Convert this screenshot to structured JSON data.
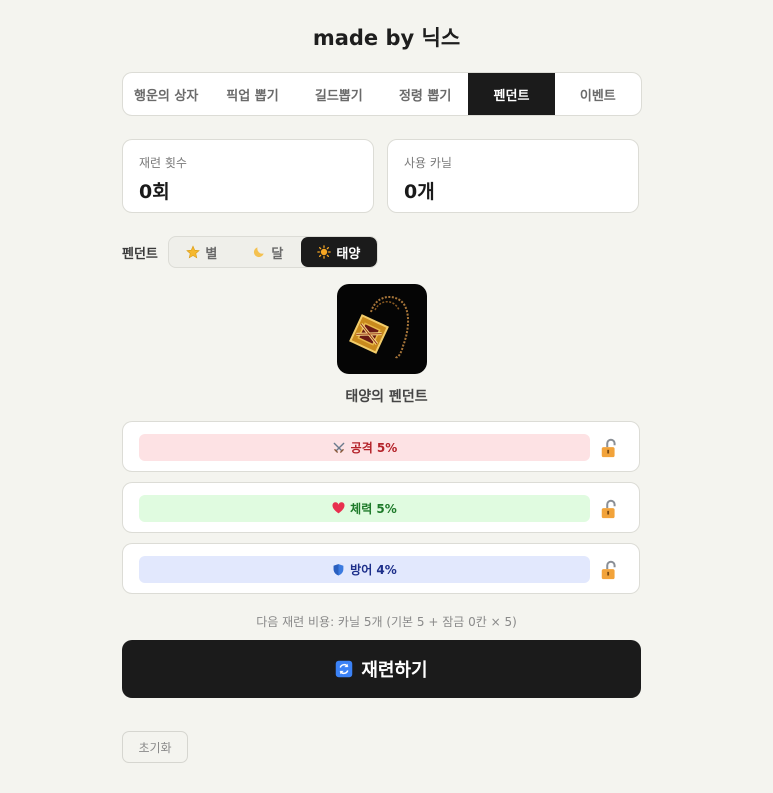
{
  "header": {
    "title": "made by 닉스"
  },
  "tabs": [
    {
      "label": "행운의 상자",
      "active": false
    },
    {
      "label": "픽업 뽑기",
      "active": false
    },
    {
      "label": "길드뽑기",
      "active": false
    },
    {
      "label": "정령 뽑기",
      "active": false
    },
    {
      "label": "펜던트",
      "active": true
    },
    {
      "label": "이벤트",
      "active": false
    }
  ],
  "stats": {
    "reroll_count": {
      "label": "재련 횟수",
      "value": "0회"
    },
    "kanil_used": {
      "label": "사용 카닐",
      "value": "0개"
    }
  },
  "pendant_type": {
    "label": "펜던트",
    "options": [
      {
        "label": "별",
        "icon": "star-icon",
        "active": false
      },
      {
        "label": "달",
        "icon": "moon-icon",
        "active": false
      },
      {
        "label": "태양",
        "icon": "sun-icon",
        "active": true
      }
    ]
  },
  "item": {
    "name": "태양의 펜던트",
    "icon": "pendant-image"
  },
  "options": [
    {
      "label": "공격 5%",
      "icon": "crossed-swords-icon",
      "bg": "#fde2e4",
      "color": "#b4232a",
      "locked": false
    },
    {
      "label": "체력 5%",
      "icon": "heart-icon",
      "bg": "#e0fbe0",
      "color": "#1e7a2a",
      "locked": false
    },
    {
      "label": "방어 4%",
      "icon": "shield-icon",
      "bg": "#e2e8fd",
      "color": "#1d2f8a",
      "locked": false
    }
  ],
  "cost_text": "다음 재련 비용: 카닐 5개 (기본 5 + 잠금 0칸 × 5)",
  "reroll_button": {
    "label": "재련하기",
    "icon": "refresh-icon"
  },
  "reset_button": {
    "label": "초기화"
  },
  "colors": {
    "accent": "#1b1b1b",
    "background": "#f4f4ef"
  }
}
